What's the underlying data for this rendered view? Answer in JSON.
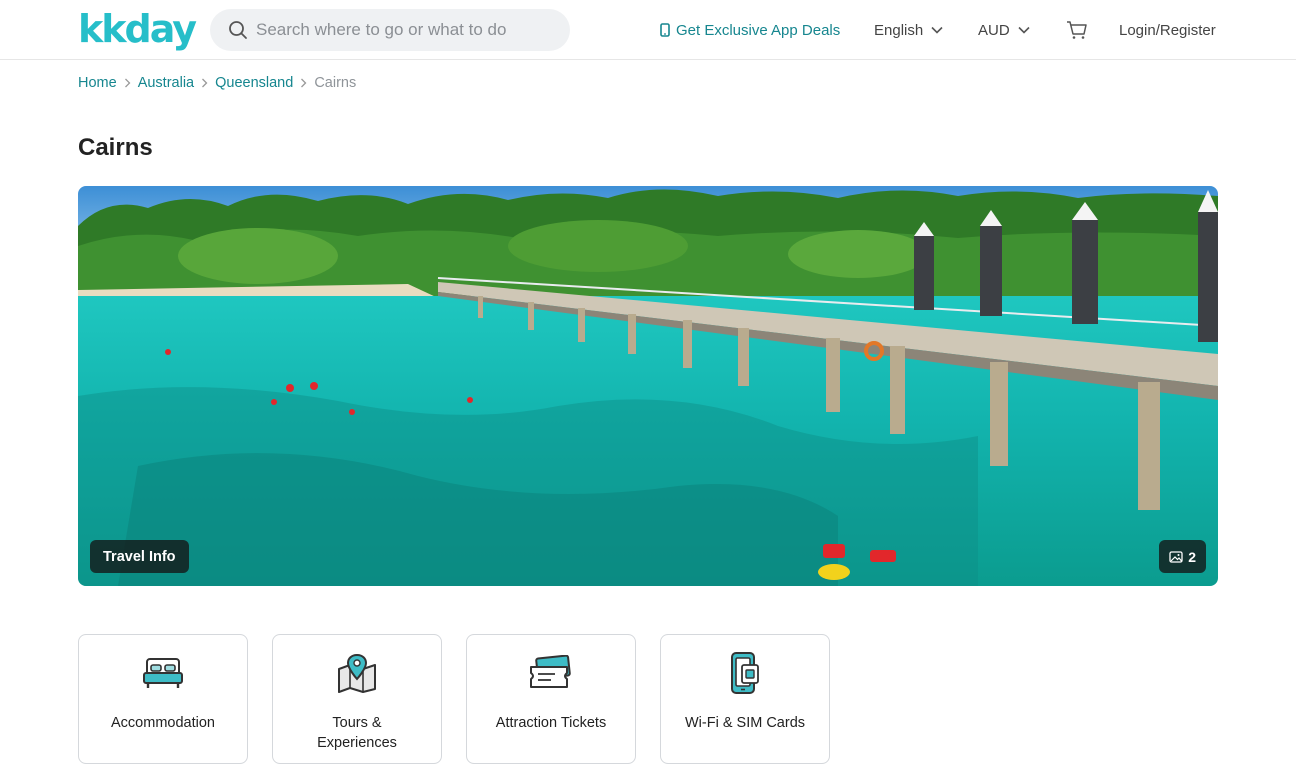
{
  "header": {
    "logo": "kkday",
    "search_placeholder": "Search where to go or what to do",
    "app_deals": "Get Exclusive App Deals",
    "language": "English",
    "currency": "AUD",
    "login": "Login/Register"
  },
  "breadcrumb": {
    "items": [
      "Home",
      "Australia",
      "Queensland"
    ],
    "current": "Cairns"
  },
  "page": {
    "title": "Cairns"
  },
  "hero": {
    "travel_info": "Travel Info",
    "photo_count": "2"
  },
  "categories": [
    {
      "label": "Accommodation",
      "icon": "bed-icon"
    },
    {
      "label": "Tours & Experiences",
      "icon": "map-pin-icon"
    },
    {
      "label": "Attraction Tickets",
      "icon": "ticket-icon"
    },
    {
      "label": "Wi-Fi & SIM Cards",
      "icon": "phone-sim-icon"
    }
  ],
  "colors": {
    "brand": "#26bec9",
    "link": "#16868f",
    "icon_accent": "#3ebcc6"
  }
}
